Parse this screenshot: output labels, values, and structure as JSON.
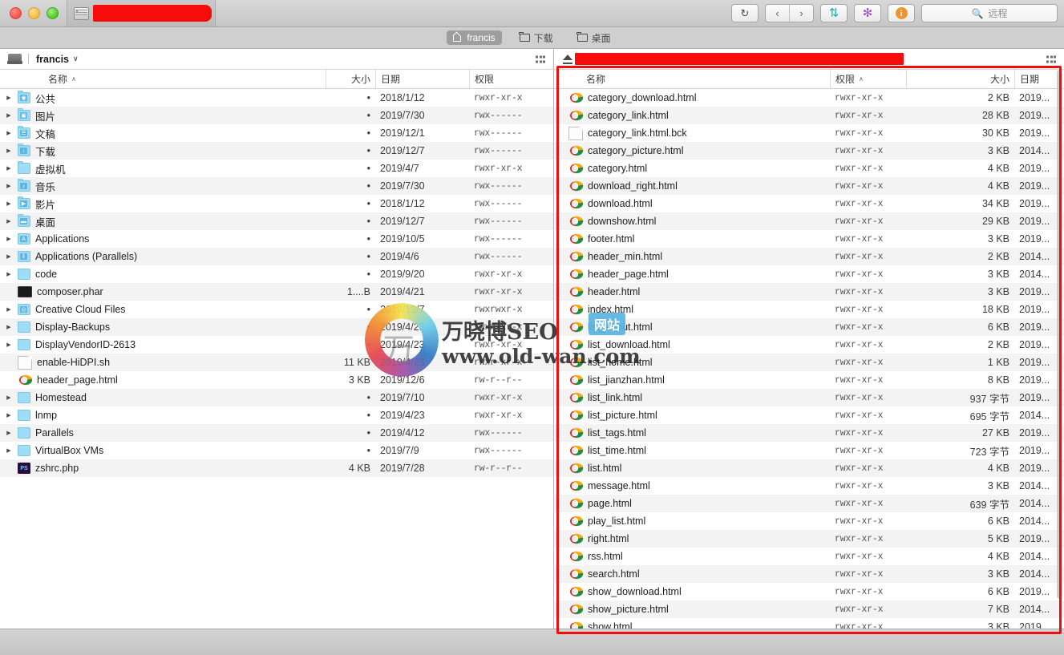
{
  "window": {
    "tab_title_redacted": true,
    "traffic_lights": [
      "close",
      "minimize",
      "zoom"
    ],
    "tab_icon": "server-rack-icon"
  },
  "toolbar": {
    "refresh_label": "↻",
    "back_label": "‹",
    "forward_label": "›",
    "transfer_label": "⇅",
    "settings_label": "✻",
    "info_label": "i",
    "search_icon": "search-icon",
    "search_placeholder": "远程"
  },
  "tabbar": {
    "tabs": [
      {
        "label": "francis",
        "icon": "home-icon",
        "selected": true
      },
      {
        "label": "下载",
        "icon": "folder-icon",
        "selected": false
      },
      {
        "label": "桌面",
        "icon": "folder-icon",
        "selected": false
      }
    ]
  },
  "left_pane": {
    "header": {
      "icon": "drive-icon",
      "title": "francis",
      "caret": "∨",
      "view_toggle_icon": "grid-view-icon"
    },
    "columns": [
      {
        "key": "name",
        "label": "名称",
        "sorted": true,
        "sort_dir": "∧"
      },
      {
        "key": "size",
        "label": "大小",
        "sorted": false,
        "sort_dir": ""
      },
      {
        "key": "date",
        "label": "日期",
        "sorted": false,
        "sort_dir": ""
      },
      {
        "key": "perm",
        "label": "权限",
        "sorted": false,
        "sort_dir": ""
      }
    ],
    "rows": [
      {
        "name": "公共",
        "icon": "folder-public",
        "glyph": "◉",
        "expandable": true,
        "size": "•",
        "date": "2018/1/12",
        "perm": "rwxr-xr-x"
      },
      {
        "name": "图片",
        "icon": "folder-pictures",
        "glyph": "▣",
        "expandable": true,
        "size": "•",
        "date": "2019/7/30",
        "perm": "rwx------"
      },
      {
        "name": "文稿",
        "icon": "folder-documents",
        "glyph": "☰",
        "expandable": true,
        "size": "•",
        "date": "2019/12/1",
        "perm": "rwx------"
      },
      {
        "name": "下载",
        "icon": "folder-downloads",
        "glyph": "↓",
        "expandable": true,
        "size": "•",
        "date": "2019/12/7",
        "perm": "rwx------"
      },
      {
        "name": "虚拟机",
        "icon": "folder-plain",
        "glyph": "",
        "expandable": true,
        "size": "•",
        "date": "2019/4/7",
        "perm": "rwxr-xr-x"
      },
      {
        "name": "音乐",
        "icon": "folder-music",
        "glyph": "♪",
        "expandable": true,
        "size": "•",
        "date": "2019/7/30",
        "perm": "rwx------"
      },
      {
        "name": "影片",
        "icon": "folder-movies",
        "glyph": "▶",
        "expandable": true,
        "size": "•",
        "date": "2018/1/12",
        "perm": "rwx------"
      },
      {
        "name": "桌面",
        "icon": "folder-desktop",
        "glyph": "▬",
        "expandable": true,
        "size": "•",
        "date": "2019/12/7",
        "perm": "rwx------"
      },
      {
        "name": "Applications",
        "icon": "folder-applications",
        "glyph": "A",
        "expandable": true,
        "size": "•",
        "date": "2019/10/5",
        "perm": "rwx------"
      },
      {
        "name": "Applications (Parallels)",
        "icon": "folder-parallels",
        "glyph": "‖",
        "expandable": true,
        "size": "•",
        "date": "2019/4/6",
        "perm": "rwx------"
      },
      {
        "name": "code",
        "icon": "folder-plain",
        "glyph": "",
        "expandable": true,
        "size": "•",
        "date": "2019/9/20",
        "perm": "rwxr-xr-x"
      },
      {
        "name": "composer.phar",
        "icon": "terminal-file",
        "glyph": "",
        "expandable": false,
        "size": "1....B",
        "date": "2019/4/21",
        "perm": "rwxr-xr-x"
      },
      {
        "name": "Creative Cloud Files",
        "icon": "folder-creative-cloud",
        "glyph": "◎",
        "expandable": true,
        "size": "•",
        "date": "2019/12/7",
        "perm": "rwxrwxr-x"
      },
      {
        "name": "Display-Backups",
        "icon": "folder-plain",
        "glyph": "",
        "expandable": true,
        "size": "•",
        "date": "2019/4/23",
        "perm": "rwxr-xr-x"
      },
      {
        "name": "DisplayVendorID-2613",
        "icon": "folder-plain",
        "glyph": "",
        "expandable": true,
        "size": "•",
        "date": "2019/4/23",
        "perm": "rwxr-xr-x"
      },
      {
        "name": "enable-HiDPI.sh",
        "icon": "document-file",
        "glyph": "",
        "expandable": false,
        "size": "11 KB",
        "date": "2019/4/23",
        "perm": "rwxr-xr-x"
      },
      {
        "name": "header_page.html",
        "icon": "chrome-file",
        "glyph": "",
        "expandable": false,
        "size": "3 KB",
        "date": "2019/12/6",
        "perm": "rw-r--r--"
      },
      {
        "name": "Homestead",
        "icon": "folder-plain",
        "glyph": "",
        "expandable": true,
        "size": "•",
        "date": "2019/7/10",
        "perm": "rwxr-xr-x"
      },
      {
        "name": "lnmp",
        "icon": "folder-plain",
        "glyph": "",
        "expandable": true,
        "size": "•",
        "date": "2019/4/23",
        "perm": "rwxr-xr-x"
      },
      {
        "name": "Parallels",
        "icon": "folder-plain",
        "glyph": "",
        "expandable": true,
        "size": "•",
        "date": "2019/4/12",
        "perm": "rwx------"
      },
      {
        "name": "VirtualBox VMs",
        "icon": "folder-plain",
        "glyph": "",
        "expandable": true,
        "size": "•",
        "date": "2019/7/9",
        "perm": "rwx------"
      },
      {
        "name": "zshrc.php",
        "icon": "photoshop-file",
        "glyph": "PS",
        "expandable": false,
        "size": "4 KB",
        "date": "2019/7/28",
        "perm": "rw-r--r--"
      }
    ]
  },
  "right_pane": {
    "header": {
      "icon": "eject-icon",
      "title_redacted": true,
      "view_toggle_icon": "grid-view-icon"
    },
    "columns": [
      {
        "key": "name",
        "label": "名称",
        "sorted": false,
        "sort_dir": ""
      },
      {
        "key": "perm",
        "label": "权限",
        "sorted": true,
        "sort_dir": "∧"
      },
      {
        "key": "size",
        "label": "大小",
        "sorted": false,
        "sort_dir": ""
      },
      {
        "key": "date",
        "label": "日期",
        "sorted": false,
        "sort_dir": ""
      }
    ],
    "rows": [
      {
        "name": "category_download.html",
        "icon": "chrome-file",
        "perm": "rwxr-xr-x",
        "size": "2 KB",
        "date": "2019..."
      },
      {
        "name": "category_link.html",
        "icon": "chrome-file",
        "perm": "rwxr-xr-x",
        "size": "28 KB",
        "date": "2019..."
      },
      {
        "name": "category_link.html.bck",
        "icon": "document-file",
        "perm": "rwxr-xr-x",
        "size": "30 KB",
        "date": "2019..."
      },
      {
        "name": "category_picture.html",
        "icon": "chrome-file",
        "perm": "rwxr-xr-x",
        "size": "3 KB",
        "date": "2014..."
      },
      {
        "name": "category.html",
        "icon": "chrome-file",
        "perm": "rwxr-xr-x",
        "size": "4 KB",
        "date": "2019..."
      },
      {
        "name": "download_right.html",
        "icon": "chrome-file",
        "perm": "rwxr-xr-x",
        "size": "4 KB",
        "date": "2019..."
      },
      {
        "name": "download.html",
        "icon": "chrome-file",
        "perm": "rwxr-xr-x",
        "size": "34 KB",
        "date": "2019..."
      },
      {
        "name": "downshow.html",
        "icon": "chrome-file",
        "perm": "rwxr-xr-x",
        "size": "29 KB",
        "date": "2019..."
      },
      {
        "name": "footer.html",
        "icon": "chrome-file",
        "perm": "rwxr-xr-x",
        "size": "3 KB",
        "date": "2019..."
      },
      {
        "name": "header_min.html",
        "icon": "chrome-file",
        "perm": "rwxr-xr-x",
        "size": "2 KB",
        "date": "2014..."
      },
      {
        "name": "header_page.html",
        "icon": "chrome-file",
        "perm": "rwxr-xr-x",
        "size": "3 KB",
        "date": "2014..."
      },
      {
        "name": "header.html",
        "icon": "chrome-file",
        "perm": "rwxr-xr-x",
        "size": "3 KB",
        "date": "2019..."
      },
      {
        "name": "index.html",
        "icon": "chrome-file",
        "perm": "rwxr-xr-x",
        "size": "18 KB",
        "date": "2019..."
      },
      {
        "name": "list_about.html",
        "icon": "chrome-file",
        "perm": "rwxr-xr-x",
        "size": "6 KB",
        "date": "2019..."
      },
      {
        "name": "list_download.html",
        "icon": "chrome-file",
        "perm": "rwxr-xr-x",
        "size": "2 KB",
        "date": "2019..."
      },
      {
        "name": "list_home.html",
        "icon": "chrome-file",
        "perm": "rwxr-xr-x",
        "size": "1 KB",
        "date": "2019..."
      },
      {
        "name": "list_jianzhan.html",
        "icon": "chrome-file",
        "perm": "rwxr-xr-x",
        "size": "8 KB",
        "date": "2019..."
      },
      {
        "name": "list_link.html",
        "icon": "chrome-file",
        "perm": "rwxr-xr-x",
        "size": "937 字节",
        "date": "2019..."
      },
      {
        "name": "list_picture.html",
        "icon": "chrome-file",
        "perm": "rwxr-xr-x",
        "size": "695 字节",
        "date": "2014..."
      },
      {
        "name": "list_tags.html",
        "icon": "chrome-file",
        "perm": "rwxr-xr-x",
        "size": "27 KB",
        "date": "2019..."
      },
      {
        "name": "list_time.html",
        "icon": "chrome-file",
        "perm": "rwxr-xr-x",
        "size": "723 字节",
        "date": "2019..."
      },
      {
        "name": "list.html",
        "icon": "chrome-file",
        "perm": "rwxr-xr-x",
        "size": "4 KB",
        "date": "2019..."
      },
      {
        "name": "message.html",
        "icon": "chrome-file",
        "perm": "rwxr-xr-x",
        "size": "3 KB",
        "date": "2014..."
      },
      {
        "name": "page.html",
        "icon": "chrome-file",
        "perm": "rwxr-xr-x",
        "size": "639 字节",
        "date": "2014..."
      },
      {
        "name": "play_list.html",
        "icon": "chrome-file",
        "perm": "rwxr-xr-x",
        "size": "6 KB",
        "date": "2014..."
      },
      {
        "name": "right.html",
        "icon": "chrome-file",
        "perm": "rwxr-xr-x",
        "size": "5 KB",
        "date": "2019..."
      },
      {
        "name": "rss.html",
        "icon": "chrome-file",
        "perm": "rwxr-xr-x",
        "size": "4 KB",
        "date": "2014..."
      },
      {
        "name": "search.html",
        "icon": "chrome-file",
        "perm": "rwxr-xr-x",
        "size": "3 KB",
        "date": "2014..."
      },
      {
        "name": "show_download.html",
        "icon": "chrome-file",
        "perm": "rwxr-xr-x",
        "size": "6 KB",
        "date": "2019..."
      },
      {
        "name": "show_picture.html",
        "icon": "chrome-file",
        "perm": "rwxr-xr-x",
        "size": "7 KB",
        "date": "2014..."
      },
      {
        "name": "show.html",
        "icon": "chrome-file",
        "perm": "rwxr-xr-x",
        "size": "3 KB",
        "date": "2019..."
      }
    ]
  },
  "watermark": {
    "char": "万",
    "line1": "万晓博SEO",
    "badge": "网站",
    "line2": "www.old-wan.com"
  },
  "annotation": {
    "highlight_color": "#f10d0d",
    "redaction_color": "#f70c0c"
  }
}
